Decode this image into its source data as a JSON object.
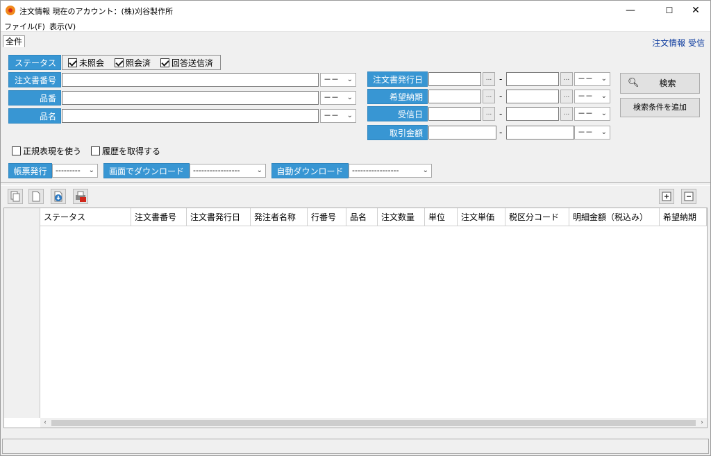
{
  "window": {
    "title": "注文情報 現在のアカウント：(株)刈谷製作所",
    "minimize": "—",
    "maximize": "☐",
    "close": "✕"
  },
  "menu": {
    "file": "ファイル(F)",
    "view": "表示(V)"
  },
  "tabs": {
    "all": "全件",
    "right_label": "注文情報 受信"
  },
  "form": {
    "status_label": "ステータス",
    "status_checks": [
      {
        "label": "未照会",
        "checked": true
      },
      {
        "label": "照会済",
        "checked": true
      },
      {
        "label": "回答送信済",
        "checked": true
      }
    ],
    "order_no_label": "注文書番号",
    "part_no_label": "品番",
    "part_name_label": "品名",
    "issue_date_label": "注文書発行日",
    "desired_date_label": "希望納期",
    "receive_date_label": "受信日",
    "amount_label": "取引金額",
    "select_default": "－－",
    "dot_btn": "...",
    "range_sep": "-",
    "regex_label": "正規表現を使う",
    "history_label": "履歴を取得する",
    "search_btn": "検索",
    "add_cond_btn": "検索条件を追加",
    "report_label": "帳票発行",
    "report_value": "---------",
    "screen_dl_label": "画面でダウンロード",
    "screen_dl_value": "-----------------",
    "auto_dl_label": "自動ダウンロード",
    "auto_dl_value": "-----------------"
  },
  "grid": {
    "columns": [
      "ステータス",
      "注文書番号",
      "注文書発行日",
      "発注者名称",
      "行番号",
      "品名",
      "注文数量",
      "単位",
      "注文単価",
      "税区分コード",
      "明細金額（税込み）",
      "希望納期"
    ]
  },
  "colors": {
    "label_bg": "#3896d3",
    "link": "#0b3a9e"
  }
}
